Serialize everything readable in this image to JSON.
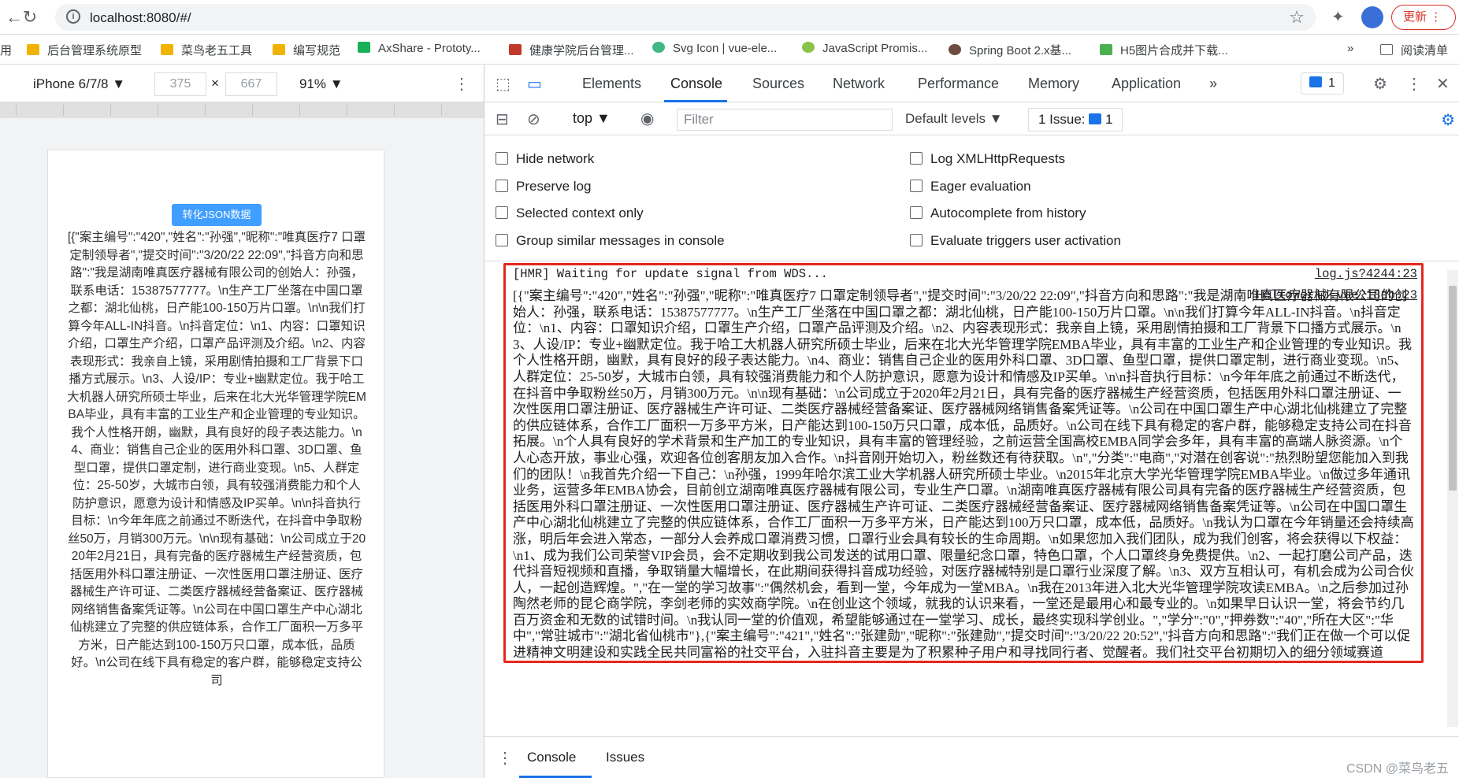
{
  "browser": {
    "url": "localhost:8080/#/",
    "update_label": "更新",
    "bookmarks": [
      "用",
      "后台管理系统原型",
      "菜鸟老五工具",
      "编写规范",
      "AxShare - Prototy...",
      "健康学院后台管理...",
      "Svg Icon | vue-ele...",
      "JavaScript Promis...",
      "Spring Boot 2.x基...",
      "H5图片合成并下载...",
      "»",
      "阅读清单"
    ]
  },
  "device_toolbar": {
    "device": "iPhone 6/7/8 ▼",
    "width": "375",
    "times": "×",
    "height": "667",
    "zoom": "91% ▼"
  },
  "phone": {
    "button_label": "转化JSON数据",
    "text": "[{\"案主编号\":\"420\",\"姓名\":\"孙强\",\"昵称\":\"唯真医疗7 口罩定制领导者\",\"提交时间\":\"3/20/22 22:09\",\"抖音方向和思路\":\"我是湖南唯真医疗器械有限公司的创始人：孙强，联系电话：15387577777。\\n生产工厂坐落在中国口罩之都：湖北仙桃，日产能100-150万片口罩。\\n\\n我们打算今年ALL-IN抖音。\\n抖音定位：\\n1、内容：口罩知识介绍，口罩生产介绍，口罩产品评测及介绍。\\n2、内容表现形式：我亲自上镜，采用剧情拍摄和工厂背景下口播方式展示。\\n3、人设/IP：专业+幽默定位。我于哈工大机器人研究所硕士毕业，后来在北大光华管理学院EMBA毕业，具有丰富的工业生产和企业管理的专业知识。我个人性格开朗，幽默，具有良好的段子表达能力。\\n4、商业：销售自己企业的医用外科口罩、3D口罩、鱼型口罩，提供口罩定制，进行商业变现。\\n5、人群定位：25-50岁，大城市白领，具有较强消费能力和个人防护意识，愿意为设计和情感及IP买单。\\n\\n抖音执行目标：\\n今年年底之前通过不断迭代，在抖音中争取粉丝50万，月销300万元。\\n\\n现有基础：\\n公司成立于2020年2月21日，具有完备的医疗器械生产经营资质，包括医用外科口罩注册证、一次性医用口罩注册证、医疗器械生产许可证、二类医疗器械经营备案证、医疗器械网络销售备案凭证等。\\n公司在中国口罩生产中心湖北仙桃建立了完整的供应链体系，合作工厂面积一万多平方米，日产能达到100-150万只口罩，成本低，品质好。\\n公司在线下具有稳定的客户群，能够稳定支持公司"
  },
  "devtools": {
    "tabs": [
      "Elements",
      "Console",
      "Sources",
      "Network",
      "Performance",
      "Memory",
      "Application"
    ],
    "more_tabs": "»",
    "issues_count": "1",
    "context": "top ▼",
    "filter_placeholder": "Filter",
    "levels": "Default levels ▼",
    "issue_label": "1 Issue:",
    "issue_num": "1",
    "options": [
      "Hide network",
      "Preserve log",
      "Selected context only",
      "Group similar messages in console",
      "Log XMLHttpRequests",
      "Eager evaluation",
      "Autocomplete from history",
      "Evaluate triggers user activation"
    ],
    "logs": {
      "hmr_text": "[HMR] Waiting for update signal from WDS...",
      "hmr_src": "log.js?4244:23",
      "json_src": "HelloWorld.vue?18db:23",
      "json_text": "[{\"案主编号\":\"420\",\"姓名\":\"孙强\",\"昵称\":\"唯真医疗7 口罩定制领导者\",\"提交时间\":\"3/20/22 22:09\",\"抖音方向和思路\":\"我是湖南唯真医疗器械有限公司的创始人：孙强，联系电话：15387577777。\\n生产工厂坐落在中国口罩之都：湖北仙桃，日产能100-150万片口罩。\\n\\n我们打算今年ALL-IN抖音。\\n抖音定位：\\n1、内容：口罩知识介绍，口罩生产介绍，口罩产品评测及介绍。\\n2、内容表现形式：我亲自上镜，采用剧情拍摄和工厂背景下口播方式展示。\\n3、人设/IP：专业+幽默定位。我于哈工大机器人研究所硕士毕业，后来在北大光华管理学院EMBA毕业，具有丰富的工业生产和企业管理的专业知识。我个人性格开朗，幽默，具有良好的段子表达能力。\\n4、商业：销售自己企业的医用外科口罩、3D口罩、鱼型口罩，提供口罩定制，进行商业变现。\\n5、人群定位：25-50岁，大城市白领，具有较强消费能力和个人防护意识，愿意为设计和情感及IP买单。\\n\\n抖音执行目标：\\n今年年底之前通过不断迭代，在抖音中争取粉丝50万，月销300万元。\\n\\n现有基础：\\n公司成立于2020年2月21日，具有完备的医疗器械生产经营资质，包括医用外科口罩注册证、一次性医用口罩注册证、医疗器械生产许可证、二类医疗器械经营备案证、医疗器械网络销售备案凭证等。\\n公司在中国口罩生产中心湖北仙桃建立了完整的供应链体系，合作工厂面积一万多平方米，日产能达到100-150万只口罩，成本低，品质好。\\n公司在线下具有稳定的客户群，能够稳定支持公司在抖音拓展。\\n个人具有良好的学术背景和生产加工的专业知识，具有丰富的管理经验，之前运营全国高校EMBA同学会多年，具有丰富的高端人脉资源。\\n个人心态开放，事业心强，欢迎各位创客朋友加入合作。\\n抖音刚开始切入，粉丝数还有待获取。\\n\",\"分类\":\"电商\",\"对潜在创客说\":\"热烈盼望您能加入到我们的团队！\\n我首先介绍一下自己：\\n孙强，1999年哈尔滨工业大学机器人研究所硕士毕业。\\n2015年北京大学光华管理学院EMBA毕业。\\n做过多年通讯业务，运营多年EMBA协会，目前创立湖南唯真医疗器械有限公司，专业生产口罩。\\n湖南唯真医疗器械有限公司具有完备的医疗器械生产经营资质，包括医用外科口罩注册证、一次性医用口罩注册证、医疗器械生产许可证、二类医疗器械经营备案证、医疗器械网络销售备案凭证等。\\n公司在中国口罩生产中心湖北仙桃建立了完整的供应链体系，合作工厂面积一万多平方米，日产能达到100万只口罩，成本低，品质好。\\n我认为口罩在今年销量还会持续高涨，明后年会进入常态，一部分人会养成口罩消费习惯，口罩行业会具有较长的生命周期。\\n如果您加入我们团队，成为我们创客，将会获得以下权益：\\n1、成为我们公司荣誉VIP会员，会不定期收到我公司发送的试用口罩、限量纪念口罩，特色口罩，个人口罩终身免费提供。\\n2、一起打磨公司产品，迭代抖音短视频和直播，争取销量大幅增长，在此期间获得抖音成功经验，对医疗器械特别是口罩行业深度了解。\\n3、双方互相认可，有机会成为公司合伙人，一起创造辉煌。\",\"在一堂的学习故事\":\"偶然机会，看到一堂，今年成为一堂MBA。\\n我在2013年进入北大光华管理学院攻读EMBA。\\n之后参加过孙陶然老师的昆仑商学院，李剑老师的实效商学院。\\n在创业这个领域，就我的认识来看，一堂还是最用心和最专业的。\\n如果早日认识一堂，将会节约几百万资金和无数的试错时间。\\n我认同一堂的价值观，希望能够通过在一堂学习、成长，最终实现科学创业。\",\"学分\":\"0\",\"押券数\":\"40\",\"所在大区\":\"华中\",\"常驻城市\":\"湖北省仙桃市\"},{\"案主编号\":\"421\",\"姓名\":\"张建勋\",\"昵称\":\"张建勋\",\"提交时间\":\"3/20/22 20:52\",\"抖音方向和思路\":\"我们正在做一个可以促进精神文明建设和实践全民共同富裕的社交平台，入驻抖音主要是为了积累种子用户和寻找同行者、觉醒者。我们社交平台初期切入的细分领域赛道"
    },
    "drawer_tabs": [
      "Console",
      "Issues"
    ],
    "watermark": "CSDN @菜鸟老五"
  },
  "colors": {
    "highlight_frame": "#e5271e",
    "accent": "#1a73e8",
    "phone_button": "#409eff"
  }
}
